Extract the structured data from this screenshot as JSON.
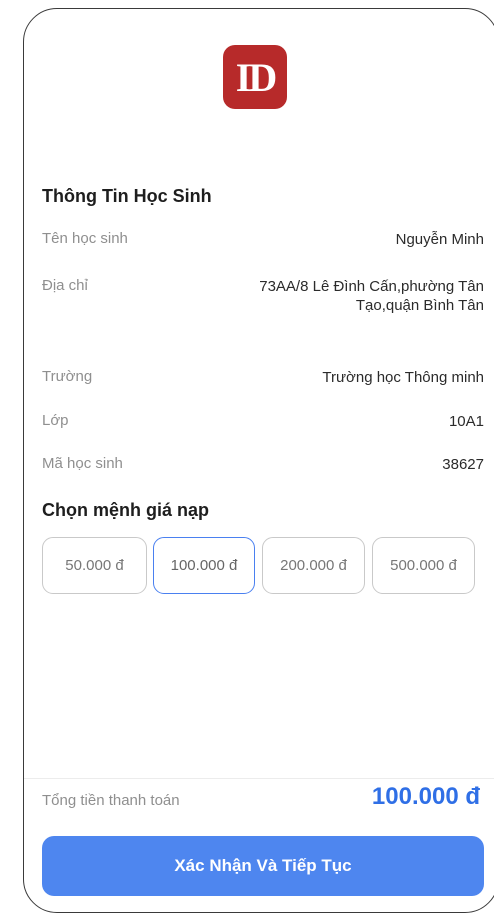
{
  "logo": {
    "text": "ID",
    "color": "#b72a2a"
  },
  "student_info": {
    "title": "Thông Tin Học Sinh",
    "rows": [
      {
        "label": "Tên học sinh",
        "value": "Nguyễn Minh"
      },
      {
        "label": "Địa chỉ",
        "value": "73AA/8 Lê Đình Cấn,phường Tân Tạo,quận Bình Tân"
      },
      {
        "label": "Trường",
        "value": "Trường học Thông minh"
      },
      {
        "label": "Lớp",
        "value": "10A1"
      },
      {
        "label": "Mã học sinh",
        "value": "38627"
      }
    ]
  },
  "denomination": {
    "title": "Chọn mệnh giá nạp",
    "options": [
      "50.000 đ",
      "100.000 đ",
      "200.000 đ",
      "500.000 đ"
    ],
    "selected": "100.000 đ"
  },
  "total": {
    "label": "Tổng tiền thanh toán",
    "value": "100.000 đ",
    "color": "#2f6fe6"
  },
  "confirm_button": {
    "label": "Xác Nhận Và Tiếp Tục",
    "color": "#4e86ef"
  }
}
